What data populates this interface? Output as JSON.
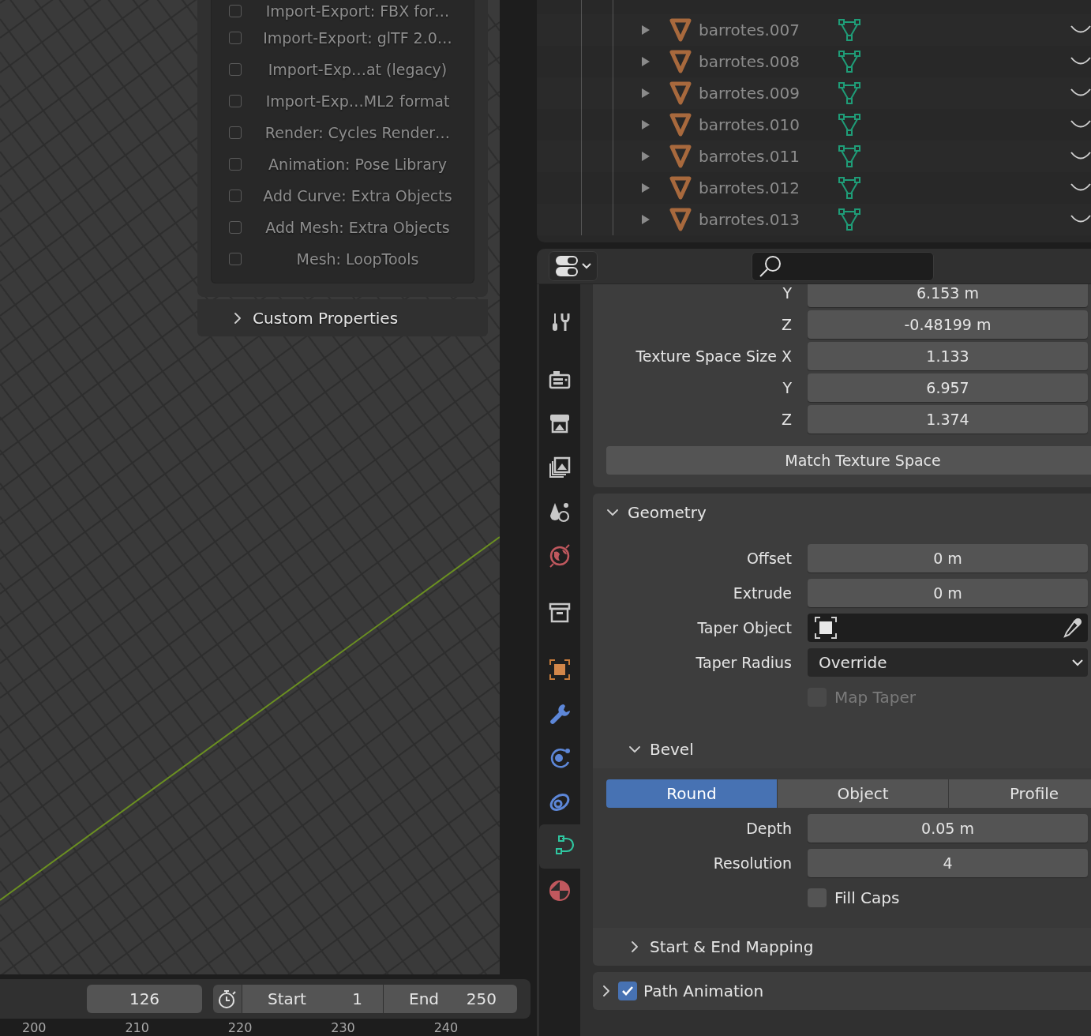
{
  "addons": {
    "items": [
      {
        "label": "Import-Export: FBX for…",
        "checked": false
      },
      {
        "label": "Import-Export: glTF 2.0…",
        "checked": false
      },
      {
        "label": "Import-Exp…at (legacy)",
        "checked": false
      },
      {
        "label": "Import-Exp…ML2 format",
        "checked": false
      },
      {
        "label": "Render: Cycles Render…",
        "checked": false
      },
      {
        "label": "Animation: Pose Library",
        "checked": false
      },
      {
        "label": "Add Curve: Extra Objects",
        "checked": false
      },
      {
        "label": "Add Mesh: Extra Objects",
        "checked": false
      },
      {
        "label": "Mesh: LoopTools",
        "checked": false
      }
    ],
    "custom_properties": {
      "title": "Custom Properties",
      "expanded": false
    }
  },
  "timeline": {
    "current_frame": "126",
    "start_label": "Start",
    "start": "1",
    "end_label": "End",
    "end": "250",
    "ruler": [
      "200",
      "210",
      "220",
      "230",
      "240"
    ]
  },
  "outliner": {
    "rows": [
      {
        "name": "barrotes.007",
        "expanded": false
      },
      {
        "name": "barrotes.008",
        "expanded": false
      },
      {
        "name": "barrotes.009",
        "expanded": false
      },
      {
        "name": "barrotes.010",
        "expanded": false
      },
      {
        "name": "barrotes.011",
        "expanded": false
      },
      {
        "name": "barrotes.012",
        "expanded": false
      },
      {
        "name": "barrotes.013",
        "expanded": false
      }
    ]
  },
  "properties": {
    "tab_groups": [
      [
        {
          "kind": "tool",
          "selected": false
        }
      ],
      [
        {
          "kind": "render",
          "selected": false
        },
        {
          "kind": "output",
          "selected": false
        },
        {
          "kind": "view_layer",
          "selected": false
        },
        {
          "kind": "scene",
          "selected": false
        },
        {
          "kind": "world",
          "selected": false
        }
      ],
      [
        {
          "kind": "collection",
          "selected": false
        }
      ],
      [
        {
          "kind": "object",
          "selected": false
        },
        {
          "kind": "modifiers",
          "selected": false
        },
        {
          "kind": "particles",
          "selected": false
        },
        {
          "kind": "physics",
          "selected": false
        },
        {
          "kind": "curve_data",
          "selected": true
        },
        {
          "kind": "material",
          "selected": false
        }
      ]
    ],
    "texture_space": {
      "rows": [
        {
          "label": "Y",
          "value": "6.153 m"
        },
        {
          "label": "Z",
          "value": "-0.48199 m"
        },
        {
          "label": "Texture Space Size X",
          "value": "1.133"
        },
        {
          "label": "Y",
          "value": "6.957"
        },
        {
          "label": "Z",
          "value": "1.374"
        }
      ],
      "button": "Match Texture Space"
    },
    "geometry": {
      "title": "Geometry",
      "expanded": true,
      "fields": [
        {
          "kind": "number",
          "label": "Offset",
          "value": "0 m"
        },
        {
          "kind": "number",
          "label": "Extrude",
          "value": "0 m"
        },
        {
          "kind": "object",
          "label": "Taper Object"
        },
        {
          "kind": "dropdown",
          "label": "Taper Radius",
          "value": "Override"
        },
        {
          "kind": "checkbox",
          "label": "Map Taper",
          "checked": false,
          "disabled": true
        }
      ],
      "bevel": {
        "title": "Bevel",
        "expanded": true,
        "modes": [
          {
            "label": "Round",
            "selected": true
          },
          {
            "label": "Object",
            "selected": false
          },
          {
            "label": "Profile",
            "selected": false
          }
        ],
        "fields": [
          {
            "kind": "number",
            "label": "Depth",
            "value": "0.05 m"
          },
          {
            "kind": "number",
            "label": "Resolution",
            "value": "4"
          },
          {
            "kind": "checkbox",
            "label": "Fill Caps",
            "checked": false,
            "disabled": false
          }
        ]
      },
      "start_end_mapping": {
        "title": "Start & End Mapping",
        "expanded": false
      }
    },
    "path_animation": {
      "title": "Path Animation",
      "expanded": false,
      "checked": true
    }
  }
}
